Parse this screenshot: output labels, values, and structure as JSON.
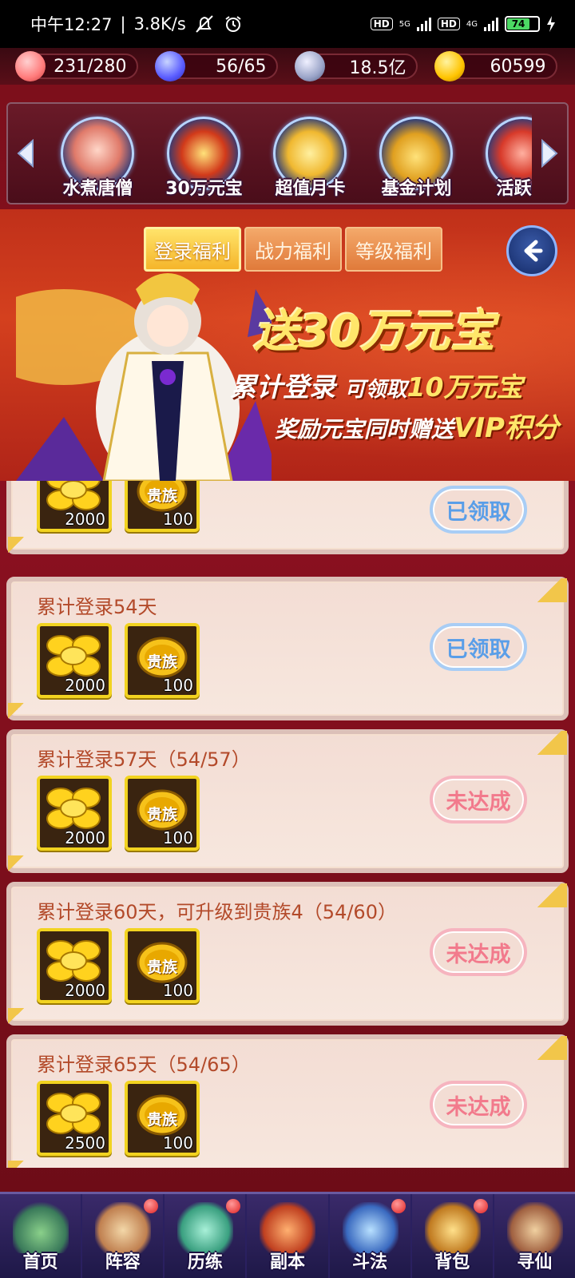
{
  "status_bar": {
    "time": "中午12:27",
    "speed": "3.8K/s",
    "hd1": "HD",
    "net1": "5G",
    "hd2": "HD",
    "net2": "4G",
    "battery": "74"
  },
  "resources": [
    {
      "icon": "peach-icon",
      "value": "231/280"
    },
    {
      "icon": "flame-icon",
      "value": "56/65"
    },
    {
      "icon": "coin-icon",
      "value": "18.5亿"
    },
    {
      "icon": "ingot-icon",
      "value": "60599"
    }
  ],
  "carousel": {
    "items": [
      {
        "label": "水煮唐僧",
        "icon": "monk-icon"
      },
      {
        "label": "30万元宝",
        "icon": "treasure-chest-icon"
      },
      {
        "label": "超值月卡",
        "icon": "month-card-icon"
      },
      {
        "label": "基金计划",
        "icon": "fund-icon"
      },
      {
        "label": "活跃战",
        "icon": "active-battle-icon"
      }
    ]
  },
  "tabs": {
    "login": "登录福利",
    "power": "战力福利",
    "level": "等级福利"
  },
  "banner": {
    "title": "送30万元宝",
    "sub1_a": "累计登录",
    "sub1_b": "可领取",
    "sub1_c": "10万元宝",
    "sub2_a": "奖励元宝同时赠送",
    "sub2_b": "VIP积分"
  },
  "rewards_list": [
    {
      "title": "",
      "rewards": [
        {
          "type": "ingot",
          "qty": "2000"
        },
        {
          "type": "noble",
          "qty": "100"
        }
      ],
      "status": "已领取",
      "state": "claimed"
    },
    {
      "title": "累计登录54天",
      "rewards": [
        {
          "type": "ingot",
          "qty": "2000"
        },
        {
          "type": "noble",
          "qty": "100"
        }
      ],
      "status": "已领取",
      "state": "claimed"
    },
    {
      "title": "累计登录57天（54/57）",
      "rewards": [
        {
          "type": "ingot",
          "qty": "2000"
        },
        {
          "type": "noble",
          "qty": "100"
        }
      ],
      "status": "未达成",
      "state": "pending"
    },
    {
      "title": "累计登录60天，可升级到贵族4（54/60）",
      "rewards": [
        {
          "type": "ingot",
          "qty": "2000"
        },
        {
          "type": "noble",
          "qty": "100"
        }
      ],
      "status": "未达成",
      "state": "pending"
    },
    {
      "title": "累计登录65天（54/65）",
      "rewards": [
        {
          "type": "ingot",
          "qty": "2500"
        },
        {
          "type": "noble",
          "qty": "100"
        }
      ],
      "status": "未达成",
      "state": "pending"
    }
  ],
  "noble_badge_text": "贵族",
  "bottom_nav": [
    {
      "label": "首页",
      "icon": "home-icon",
      "dot": false
    },
    {
      "label": "阵容",
      "icon": "lineup-icon",
      "dot": true
    },
    {
      "label": "历练",
      "icon": "training-icon",
      "dot": true
    },
    {
      "label": "副本",
      "icon": "dungeon-icon",
      "dot": false
    },
    {
      "label": "斗法",
      "icon": "battle-icon",
      "dot": true
    },
    {
      "label": "背包",
      "icon": "bag-icon",
      "dot": true
    },
    {
      "label": "寻仙",
      "icon": "seek-immortal-icon",
      "dot": false
    }
  ]
}
